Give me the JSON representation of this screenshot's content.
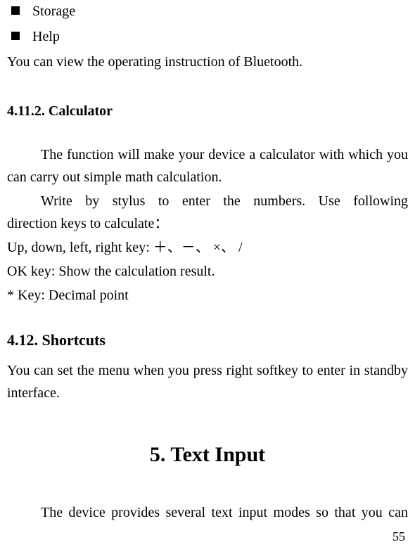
{
  "bullets": {
    "item0": "Storage",
    "item1": "Help"
  },
  "help_desc": "You can view the operating instruction of Bluetooth.",
  "calculator": {
    "heading": "4.11.2.  Calculator",
    "para1": "The function will make your device a calculator with which you can carry out simple math calculation.",
    "para2a": "Write  by  stylus  to  enter  the  numbers.  Use  following",
    "para2b": "direction keys to calculate：",
    "line_keys": "Up, down, left, right key:  ＋、－、 ×、 /",
    "line_ok": "OK key: Show the calculation result.",
    "line_star": "* Key: Decimal point"
  },
  "shortcuts": {
    "heading": "4.12. Shortcuts",
    "para": "You can set the menu when you press right softkey to enter in standby interface."
  },
  "text_input": {
    "heading": "5.   Text Input",
    "para": "The device provides several text input modes so that you can"
  },
  "page_number": "55"
}
